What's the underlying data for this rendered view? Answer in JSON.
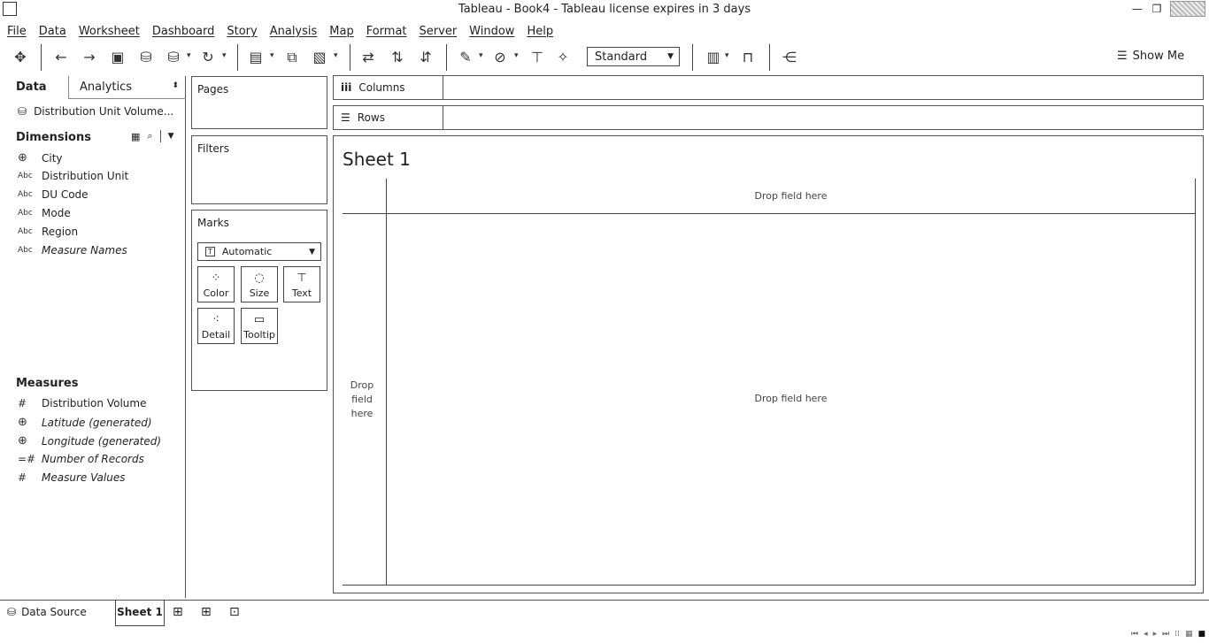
{
  "window": {
    "title": "Tableau - Book4 - Tableau license expires in 3 days"
  },
  "menu": [
    "File",
    "Data",
    "Worksheet",
    "Dashboard",
    "Story",
    "Analysis",
    "Map",
    "Format",
    "Server",
    "Window",
    "Help"
  ],
  "toolbar": {
    "fit_value": "Standard",
    "show_me_label": "Show Me"
  },
  "data_pane": {
    "tabs": {
      "data": "Data",
      "analytics": "Analytics"
    },
    "datasource": "Distribution Unit Volume...",
    "dimensions_header": "Dimensions",
    "dimensions": [
      {
        "type": "geo",
        "name": "City"
      },
      {
        "type": "Abc",
        "name": "Distribution Unit"
      },
      {
        "type": "Abc",
        "name": "DU Code"
      },
      {
        "type": "Abc",
        "name": "Mode"
      },
      {
        "type": "Abc",
        "name": "Region"
      },
      {
        "type": "Abc",
        "name": "Measure Names"
      }
    ],
    "measures_header": "Measures",
    "measures": [
      {
        "type": "#",
        "name": "Distribution Volume"
      },
      {
        "type": "geo",
        "name": "Latitude (generated)"
      },
      {
        "type": "geo",
        "name": "Longitude (generated)"
      },
      {
        "type": "=#",
        "name": "Number of Records"
      },
      {
        "type": "#",
        "name": "Measure Values"
      }
    ]
  },
  "cards": {
    "pages": "Pages",
    "filters": "Filters",
    "marks": "Marks",
    "mark_type": "Automatic",
    "mark_buttons": [
      "Color",
      "Size",
      "Text",
      "Detail",
      "Tooltip"
    ]
  },
  "shelves": {
    "columns": "Columns",
    "rows": "Rows"
  },
  "view": {
    "sheet_title": "Sheet 1",
    "drop_top": "Drop field here",
    "drop_center": "Drop field here",
    "drop_left": "Drop field here"
  },
  "bottom": {
    "datasource_tab": "Data Source",
    "sheet_tab": "Sheet 1"
  }
}
